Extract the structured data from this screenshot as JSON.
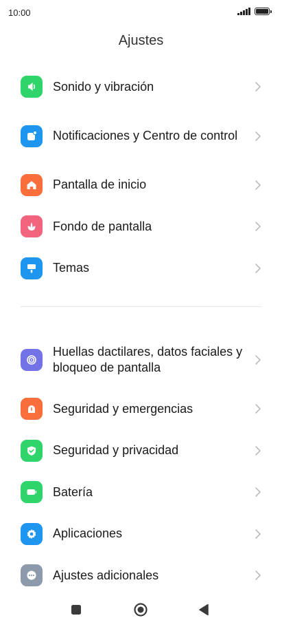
{
  "status": {
    "time": "10:00",
    "battery_level": 1.0
  },
  "header": {
    "title": "Ajustes"
  },
  "section1": [
    {
      "label": "Sonido y vibración",
      "icon": "speaker-icon",
      "color": "#2fd46a"
    },
    {
      "label": "Notificaciones y Centro de control",
      "icon": "notification-icon",
      "color": "#1e96f0"
    },
    {
      "label": "Pantalla de inicio",
      "icon": "home-icon",
      "color": "#fa6e3c"
    },
    {
      "label": "Fondo de pantalla",
      "icon": "flower-icon",
      "color": "#f2637e"
    },
    {
      "label": "Temas",
      "icon": "theme-brush-icon",
      "color": "#1e96f0"
    }
  ],
  "section2": [
    {
      "label": "Huellas dactilares, datos faciales y bloqueo de pantalla",
      "icon": "fingerprint-icon",
      "color": "#7372e6"
    },
    {
      "label": "Seguridad y emergencias",
      "icon": "emergency-icon",
      "color": "#fa6e3c"
    },
    {
      "label": "Seguridad y privacidad",
      "icon": "shield-check-icon",
      "color": "#2fd46a"
    },
    {
      "label": "Batería",
      "icon": "battery-icon",
      "color": "#2fd46a"
    },
    {
      "label": "Aplicaciones",
      "icon": "gear-icon",
      "color": "#1e96f0"
    },
    {
      "label": "Ajustes adicionales",
      "icon": "more-dots-icon",
      "color": "#8c9aab"
    }
  ],
  "nav": {
    "recents": "recents-icon",
    "home": "home-circle-icon",
    "back": "back-icon"
  }
}
